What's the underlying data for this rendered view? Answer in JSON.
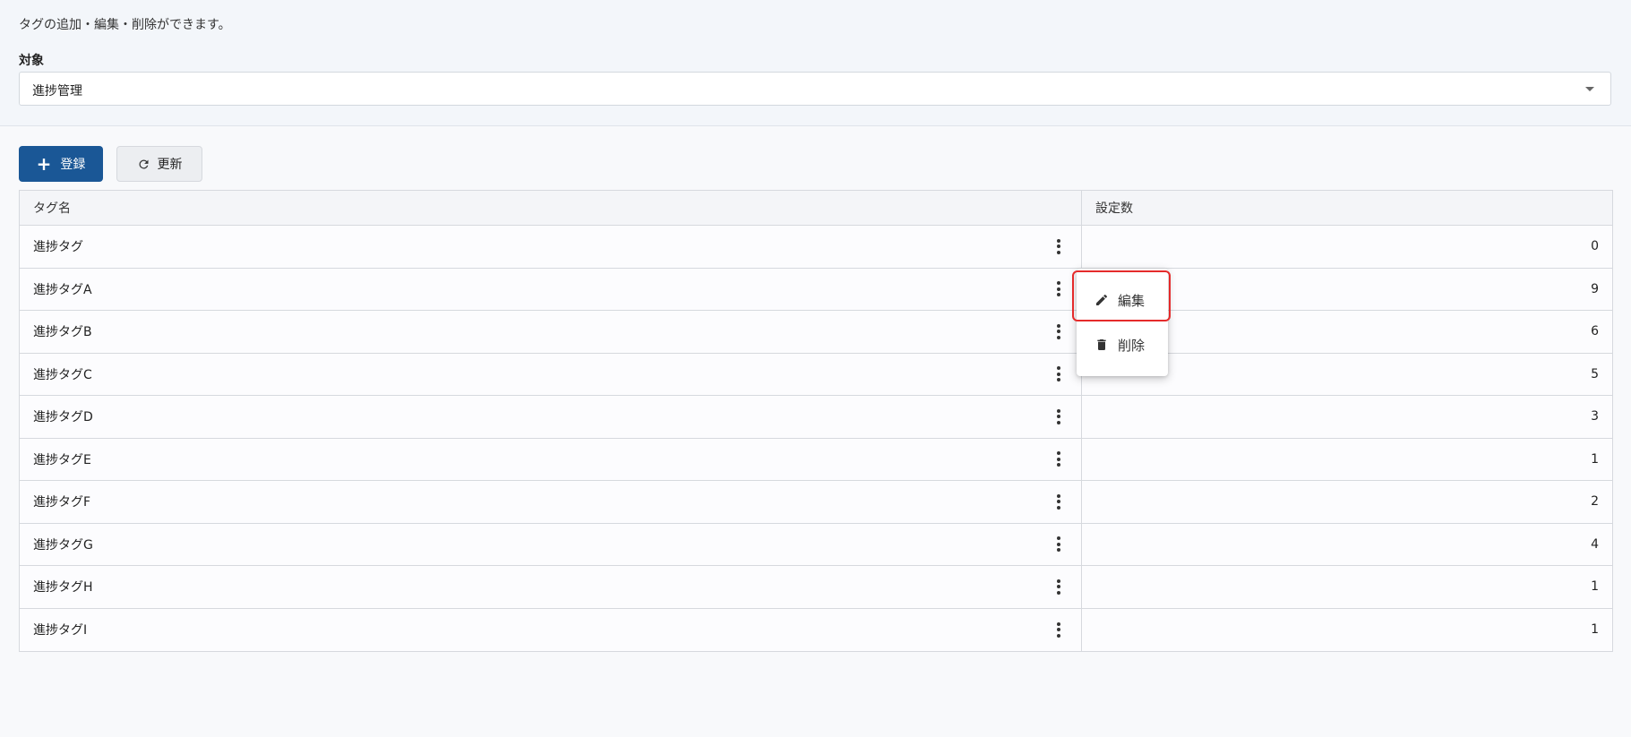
{
  "header": {
    "description": "タグの追加・編集・削除ができます。",
    "target_label": "対象",
    "target_value": "進捗管理"
  },
  "toolbar": {
    "register_label": "登録",
    "refresh_label": "更新"
  },
  "table": {
    "columns": [
      "タグ名",
      "設定数"
    ],
    "rows": [
      {
        "name": "進捗タグ",
        "count": "0"
      },
      {
        "name": "進捗タグA",
        "count": "9"
      },
      {
        "name": "進捗タグB",
        "count": "6"
      },
      {
        "name": "進捗タグC",
        "count": "5"
      },
      {
        "name": "進捗タグD",
        "count": "3"
      },
      {
        "name": "進捗タグE",
        "count": "1"
      },
      {
        "name": "進捗タグF",
        "count": "2"
      },
      {
        "name": "進捗タグG",
        "count": "4"
      },
      {
        "name": "進捗タグH",
        "count": "1"
      },
      {
        "name": "進捗タグI",
        "count": "1"
      }
    ]
  },
  "context_menu": {
    "edit_label": "編集",
    "delete_label": "削除",
    "edit_icon": "pencil-icon",
    "delete_icon": "trash-icon"
  },
  "colors": {
    "primary": "#1a5796",
    "highlight": "#e52b2b"
  }
}
